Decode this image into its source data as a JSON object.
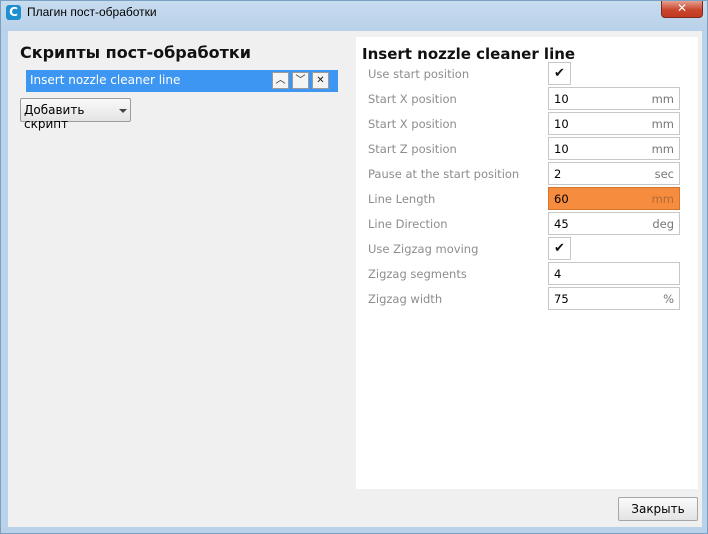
{
  "window": {
    "title": "Плагин пост-обработки",
    "app_icon": "C"
  },
  "left": {
    "heading": "Скрипты пост-обработки",
    "scripts": [
      {
        "label": "Insert nozzle cleaner line"
      }
    ],
    "add_script_label": "Добавить скрипт"
  },
  "right": {
    "heading": "Insert nozzle cleaner line",
    "settings": [
      {
        "label": "Use start position",
        "type": "checkbox",
        "checked": true
      },
      {
        "label": "Start X position",
        "type": "number",
        "value": "10",
        "unit": "mm"
      },
      {
        "label": "Start X position",
        "type": "number",
        "value": "10",
        "unit": "mm"
      },
      {
        "label": "Start Z position",
        "type": "number",
        "value": "10",
        "unit": "mm"
      },
      {
        "label": "Pause at the start position",
        "type": "number",
        "value": "2",
        "unit": "sec"
      },
      {
        "label": "Line Length",
        "type": "number",
        "value": "60",
        "unit": "mm",
        "error": true
      },
      {
        "label": "Line Direction",
        "type": "number",
        "value": "45",
        "unit": "deg"
      },
      {
        "label": "Use Zigzag moving",
        "type": "checkbox",
        "checked": true
      },
      {
        "label": "Zigzag segments",
        "type": "number",
        "value": "4",
        "unit": ""
      },
      {
        "label": "Zigzag width",
        "type": "number",
        "value": "75",
        "unit": "%"
      }
    ]
  },
  "footer": {
    "close_label": "Закрыть"
  },
  "colors": {
    "selection": "#3d97f2",
    "error_field": "#f58c3e",
    "titlebar": "#c8dcef"
  },
  "icons": {
    "move_up": "chevron-up-icon",
    "move_down": "chevron-down-icon",
    "remove": "close-icon",
    "checkmark": "checkmark-icon"
  }
}
